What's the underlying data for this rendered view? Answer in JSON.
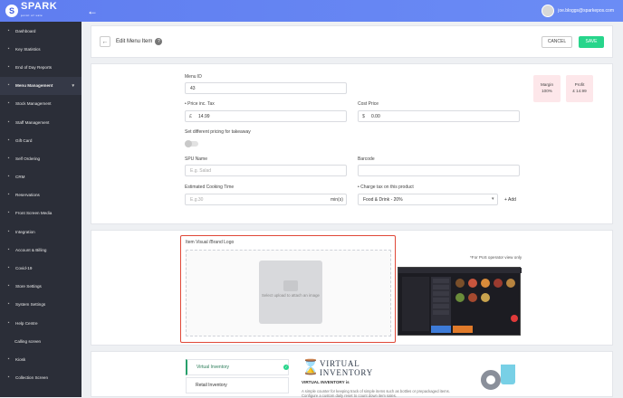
{
  "topbar": {
    "logo_mark": "S",
    "logo_text": "SPARK",
    "logo_sub": "point of sale",
    "user_email": "joe.bloggs@sparkepos.com"
  },
  "sidebar": {
    "items": [
      {
        "label": "Dashboard",
        "icon": "dashboard-icon"
      },
      {
        "label": "Key Statistics",
        "icon": "chart-icon"
      },
      {
        "label": "End of Day Reports",
        "icon": "report-icon"
      },
      {
        "label": "Menu Management",
        "icon": "menu-icon",
        "active": true
      },
      {
        "label": "Stock Management",
        "icon": "stock-icon"
      },
      {
        "label": "Staff Management",
        "icon": "staff-icon"
      },
      {
        "label": "Gift Card",
        "icon": "gift-icon"
      },
      {
        "label": "Self Ordering",
        "icon": "self-order-icon"
      },
      {
        "label": "CRM",
        "icon": "crm-icon"
      },
      {
        "label": "Reservations",
        "icon": "calendar-icon"
      },
      {
        "label": "Front Screen Media",
        "icon": "media-icon"
      },
      {
        "label": "Integration",
        "icon": "integration-icon"
      },
      {
        "label": "Account & Billing",
        "icon": "billing-icon"
      },
      {
        "label": "Covid-19",
        "icon": "covid-icon"
      },
      {
        "label": "Store Settings",
        "icon": "store-icon"
      },
      {
        "label": "System Settings",
        "icon": "settings-icon"
      },
      {
        "label": "Help Centre",
        "icon": "help-icon"
      },
      {
        "label": "Calling screen",
        "icon": ""
      },
      {
        "label": "Kiosk",
        "icon": "kiosk-icon"
      },
      {
        "label": "Collection Screen",
        "icon": "collection-icon"
      }
    ]
  },
  "header": {
    "title": "Edit Menu Item",
    "cancel_label": "CANCEL",
    "save_label": "SAVE"
  },
  "form": {
    "menu_id_label": "Menu ID",
    "menu_id_value": "43",
    "price_label": "• Price inc. Tax",
    "price_currency": "£",
    "price_value": "14.99",
    "cost_label": "Cost Price",
    "cost_currency": "$",
    "cost_value": "0.00",
    "takeaway_label": "Set different pricing for takeaway",
    "spu_label": "SPU Name",
    "spu_placeholder": "E.g. Salad",
    "barcode_label": "Barcode",
    "cooking_label": "Estimated Cooking Time",
    "cooking_placeholder": "E.g.30",
    "cooking_unit": "min(s)",
    "tax_label": "• Charge tax on this product",
    "tax_value": "Food & Drink - 20%",
    "add_label": "+ Add",
    "margin_label": "Margin",
    "margin_value": "100%",
    "profit_label": "Profit",
    "profit_value": "£ 14.99"
  },
  "visual": {
    "title": "Item Visual /Brand Logo",
    "upload_hint": "Select upload to attach an image",
    "pos_note": "*For PoS operator view only"
  },
  "inventory": {
    "tabs": [
      "Virtual Inventory",
      "Retail Inventory"
    ],
    "title_line1": "VIRTUAL",
    "title_line2": "INVENTORY",
    "subtitle": "VIRTUAL INVENTORY is",
    "description": "A simple counter for keeping track of simple items such as bottles or prepackaged items. Configure a custom daily reset to count down item sales."
  }
}
